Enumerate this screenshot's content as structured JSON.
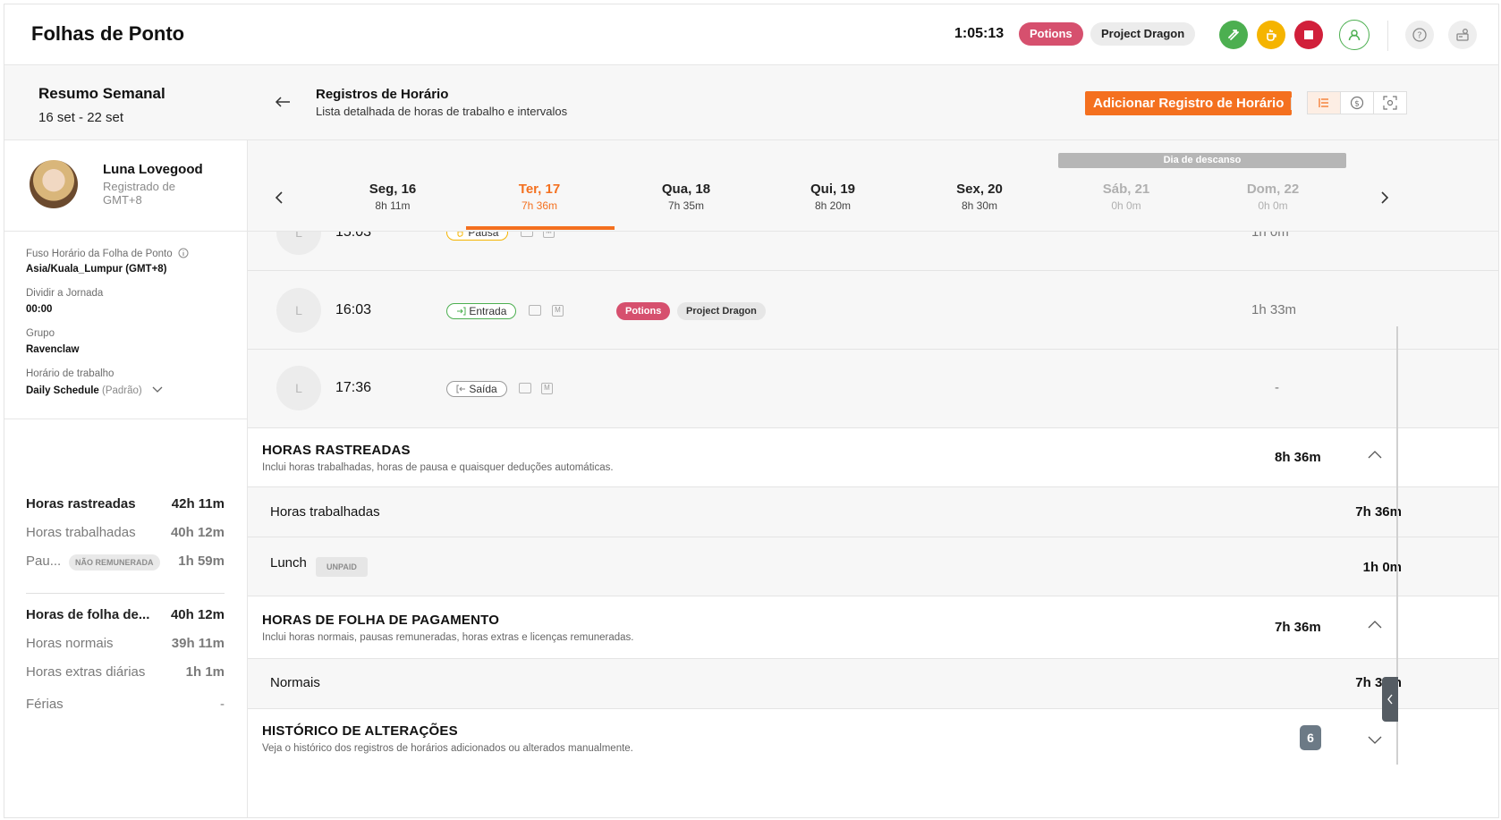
{
  "header": {
    "app_title": "Folhas de Ponto",
    "timer": "1:05:13",
    "activity_chip": "Potions",
    "project_chip": "Project Dragon",
    "icons": [
      "switch-icon",
      "break-icon",
      "stop-icon",
      "user-icon",
      "help-icon",
      "settings-icon"
    ],
    "colors": {
      "accent": "#f4701f",
      "potions": "#d6506e",
      "green": "#4caf50",
      "yellow": "#f5b400",
      "red": "#d11f3a"
    }
  },
  "sidebar": {
    "summary_title": "Resumo Semanal",
    "summary_dates": "16 set - 22 set",
    "user": {
      "name": "Luna Lovegood",
      "subtitle": "Registrado de GMT+8"
    },
    "info": {
      "timezone_label": "Fuso Horário da Folha de Ponto",
      "timezone_value": "Asia/Kuala_Lumpur (GMT+8)",
      "split_label": "Dividir a Jornada",
      "split_value": "00:00",
      "group_label": "Grupo",
      "group_value": "Ravenclaw",
      "schedule_label": "Horário de trabalho",
      "schedule_value": "Daily Schedule",
      "schedule_tag": "(Padrão)"
    },
    "totals": {
      "tracked_label": "Horas rastreadas",
      "tracked_value": "42h 11m",
      "worked_label": "Horas trabalhadas",
      "worked_value": "40h 12m",
      "pause_label": "Pau...",
      "pause_badge": "NÃO REMUNERADA",
      "pause_value": "1h 59m",
      "payroll_label": "Horas de folha de...",
      "payroll_value": "40h 12m",
      "regular_label": "Horas normais",
      "regular_value": "39h 11m",
      "overtime_label": "Horas extras diárias",
      "overtime_value": "1h 1m",
      "vacation_label": "Férias",
      "vacation_value": "-"
    }
  },
  "main": {
    "title": "Registros de Horário",
    "subtitle": "Lista detalhada de horas de trabalho e intervalos",
    "add_button": "Adicionar Registro de Horário",
    "view_icons": [
      "list-view-icon",
      "dollar-icon",
      "screenshot-icon"
    ],
    "rest_label": "Dia de descanso",
    "days": [
      {
        "name": "Seg, 16",
        "hours": "8h 11m"
      },
      {
        "name": "Ter, 17",
        "hours": "7h 36m"
      },
      {
        "name": "Qua, 18",
        "hours": "7h 35m"
      },
      {
        "name": "Qui, 19",
        "hours": "8h 20m"
      },
      {
        "name": "Sex, 20",
        "hours": "8h 30m"
      },
      {
        "name": "Sáb, 21",
        "hours": "0h 0m"
      },
      {
        "name": "Dom, 22",
        "hours": "0h 0m"
      }
    ],
    "entries": [
      {
        "initial": "L",
        "time": "15:03",
        "type": "Pausa",
        "duration": "1h 0m"
      },
      {
        "initial": "L",
        "time": "16:03",
        "type": "Entrada",
        "activity": "Potions",
        "project": "Project Dragon",
        "duration": "1h 33m"
      },
      {
        "initial": "L",
        "time": "17:36",
        "type": "Saída",
        "duration": "-"
      }
    ],
    "manual_mark": "M",
    "tracked": {
      "title": "HORAS RASTREADAS",
      "subtitle": "Inclui horas trabalhadas, horas de pausa e quaisquer deduções automáticas.",
      "value": "8h 36m",
      "rows": [
        {
          "label": "Horas trabalhadas",
          "value": "7h 36m"
        },
        {
          "label": "Lunch",
          "badge": "UNPAID",
          "value": "1h 0m"
        }
      ]
    },
    "payroll": {
      "title": "HORAS DE FOLHA DE PAGAMENTO",
      "subtitle": "Inclui horas normais, pausas remuneradas, horas extras e licenças remuneradas.",
      "value": "7h 36m",
      "rows": [
        {
          "label": "Normais",
          "value": "7h 36m"
        }
      ]
    },
    "history": {
      "title": "HISTÓRICO DE ALTERAÇÕES",
      "subtitle": "Veja o histórico dos registros de horários adicionados ou alterados manualmente.",
      "count": "6"
    }
  }
}
